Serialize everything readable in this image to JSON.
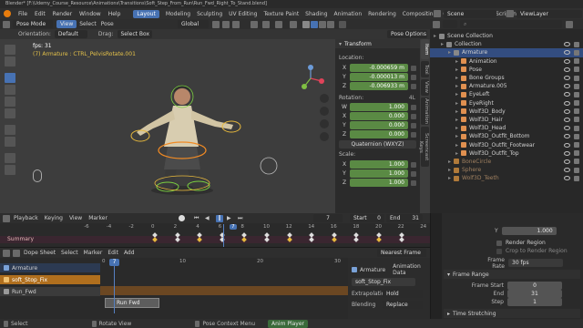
{
  "window": {
    "title": "Blender* [F:\\Udemy_Course_Resource\\Animations\\Transitions\\Soft_Step_From_Run\\Run_Fwd_Right_To_Stand.blend]"
  },
  "menu": {
    "items": [
      "File",
      "Edit",
      "Render",
      "Window",
      "Help"
    ]
  },
  "workspaces": [
    "Layout",
    "Modeling",
    "Sculpting",
    "UV Editing",
    "Texture Paint",
    "Shading",
    "Animation",
    "Rendering",
    "Compositing",
    "Geometry Nodes",
    "Scripting"
  ],
  "workspace_active": "Layout",
  "scene": {
    "label": "Scene",
    "view_layer": "ViewLayer"
  },
  "viewport": {
    "mode": "Pose Mode",
    "menus": [
      "View",
      "Select",
      "Pose"
    ],
    "transform_orientation": "Global",
    "orientation_label": "Orientation:",
    "orientation_value": "Default",
    "drag_label": "Drag:",
    "drag_value": "Select Box",
    "options": "Pose Options",
    "fps": "fps: 31",
    "info": "(7) Armature : CTRL_PelvisRotate.001",
    "side_tabs": [
      "Item",
      "Tool",
      "View",
      "Animation",
      "Screencast Keys"
    ]
  },
  "npanel": {
    "title": "Transform",
    "location_label": "Location:",
    "location": [
      {
        "axis": "X",
        "value": "-0.000659 m"
      },
      {
        "axis": "Y",
        "value": "-0.000013 m"
      },
      {
        "axis": "Z",
        "value": "-0.006933 m"
      }
    ],
    "rotation_label": "Rotation:",
    "rotation_mode_short": "4L",
    "rotation": [
      {
        "axis": "W",
        "value": "1.000"
      },
      {
        "axis": "X",
        "value": "0.000"
      },
      {
        "axis": "Y",
        "value": "0.000"
      },
      {
        "axis": "Z",
        "value": "0.000"
      }
    ],
    "rotation_mode": "Quaternion (WXYZ)",
    "scale_label": "Scale:",
    "scale": [
      {
        "axis": "X",
        "value": "1.000"
      },
      {
        "axis": "Y",
        "value": "1.000"
      },
      {
        "axis": "Z",
        "value": "1.000"
      }
    ]
  },
  "outliner": {
    "title": "Scene Collection",
    "rows": [
      {
        "label": "Scene Collection",
        "indent": 0,
        "selected": false
      },
      {
        "label": "Collection",
        "indent": 1,
        "selected": false
      },
      {
        "label": "Armature",
        "indent": 2,
        "selected": true
      },
      {
        "label": "Animation",
        "indent": 3,
        "selected": false
      },
      {
        "label": "Pose",
        "indent": 3,
        "selected": false
      },
      {
        "label": "Bone Groups",
        "indent": 3,
        "selected": false
      },
      {
        "label": "Armature.005",
        "indent": 3,
        "selected": false
      },
      {
        "label": "EyeLeft",
        "indent": 3,
        "selected": false
      },
      {
        "label": "EyeRight",
        "indent": 3,
        "selected": false
      },
      {
        "label": "Wolf3D_Body",
        "indent": 3,
        "selected": false
      },
      {
        "label": "Wolf3D_Hair",
        "indent": 3,
        "selected": false
      },
      {
        "label": "Wolf3D_Head",
        "indent": 3,
        "selected": false
      },
      {
        "label": "Wolf3D_Outfit_Bottom",
        "indent": 3,
        "selected": false
      },
      {
        "label": "Wolf3D_Outfit_Footwear",
        "indent": 3,
        "selected": false
      },
      {
        "label": "Wolf3D_Outfit_Top",
        "indent": 3,
        "selected": false
      },
      {
        "label": "BoneCircle",
        "indent": 2,
        "selected": false
      },
      {
        "label": "Sphere",
        "indent": 2,
        "selected": false
      },
      {
        "label": "Wolf3D_Teeth",
        "indent": 2,
        "selected": false
      }
    ]
  },
  "timeline": {
    "menus": [
      "Playback",
      "Keying",
      "View",
      "Marker"
    ],
    "current_frame": "7",
    "start_label": "Start",
    "start": "0",
    "end_label": "End",
    "end": "31",
    "ruler": [
      "-6",
      "-4",
      "-2",
      "0",
      "2",
      "4",
      "6",
      "7",
      "8",
      "10",
      "12",
      "14",
      "16",
      "18",
      "20",
      "22",
      "24"
    ],
    "summary_label": "Summary"
  },
  "nla": {
    "menus": [
      "Dope Sheet",
      "Select",
      "Marker",
      "Edit",
      "Add"
    ],
    "nearest_frame": "Nearest Frame",
    "current_frame": "7",
    "ruler": [
      "0",
      "7",
      "10",
      "20",
      "30"
    ],
    "tracks": [
      {
        "name": "Armature"
      },
      {
        "name": "soft_Stop_Fix"
      },
      {
        "name": "Run_Fwd"
      }
    ],
    "strip_label": "Run Fwd",
    "action_panel": {
      "object": "Armature",
      "data": "Animation Data",
      "action": "soft_Stop_Fix",
      "extrapolation_label": "Extrapolation",
      "extrapolation": "Hold",
      "blending_label": "Blending",
      "blending": "Replace"
    }
  },
  "properties": {
    "y_label": "Y",
    "y_value": "1.000",
    "render_region": "Render Region",
    "crop": "Crop to Render Region",
    "frame_rate_label": "Frame Rate",
    "frame_rate": "30 fps",
    "frame_range_title": "Frame Range",
    "frame_start_label": "Frame Start",
    "frame_start": "0",
    "end_label": "End",
    "end": "31",
    "step_label": "Step",
    "step": "1",
    "time_stretching": "Time Stretching"
  },
  "statusbar": {
    "items": [
      "Select",
      "Rotate View",
      "Pose Context Menu",
      "Anim Player"
    ]
  }
}
